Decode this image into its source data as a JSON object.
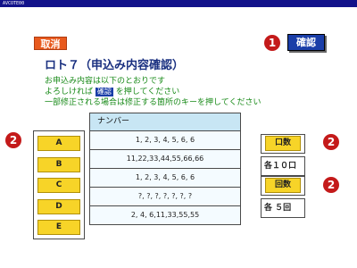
{
  "window": {
    "title": "AVCOTE00"
  },
  "cancel_label": "取消",
  "confirm_label": "確認",
  "markers": {
    "confirm": "1",
    "letters": "2",
    "count": "2",
    "times": "2"
  },
  "title": "ロト７（申込み内容確認）",
  "instructions": {
    "line1": "お申込み内容は以下のとおりです",
    "line2_pre": "よろしければ",
    "line2_key": "確認",
    "line2_post": "を押してください",
    "line3": "一部修正される場合は修正する箇所のキーを押してください"
  },
  "table": {
    "header": "ナンバー",
    "rows": [
      {
        "letter": "A",
        "numbers": "1, 2, 3, 4, 5, 6, 6"
      },
      {
        "letter": "B",
        "numbers": "11,22,33,44,55,66,66"
      },
      {
        "letter": "C",
        "numbers": "1, 2, 3, 4, 5, 6, 6"
      },
      {
        "letter": "D",
        "numbers": "?, ?, ?, ?, ?, ?, ?"
      },
      {
        "letter": "E",
        "numbers": "2, 4, 6,11,33,55,55"
      }
    ]
  },
  "side": {
    "count_label": "口数",
    "count_value": "各１０口",
    "times_label": "回数",
    "times_value": "各  ５回"
  }
}
